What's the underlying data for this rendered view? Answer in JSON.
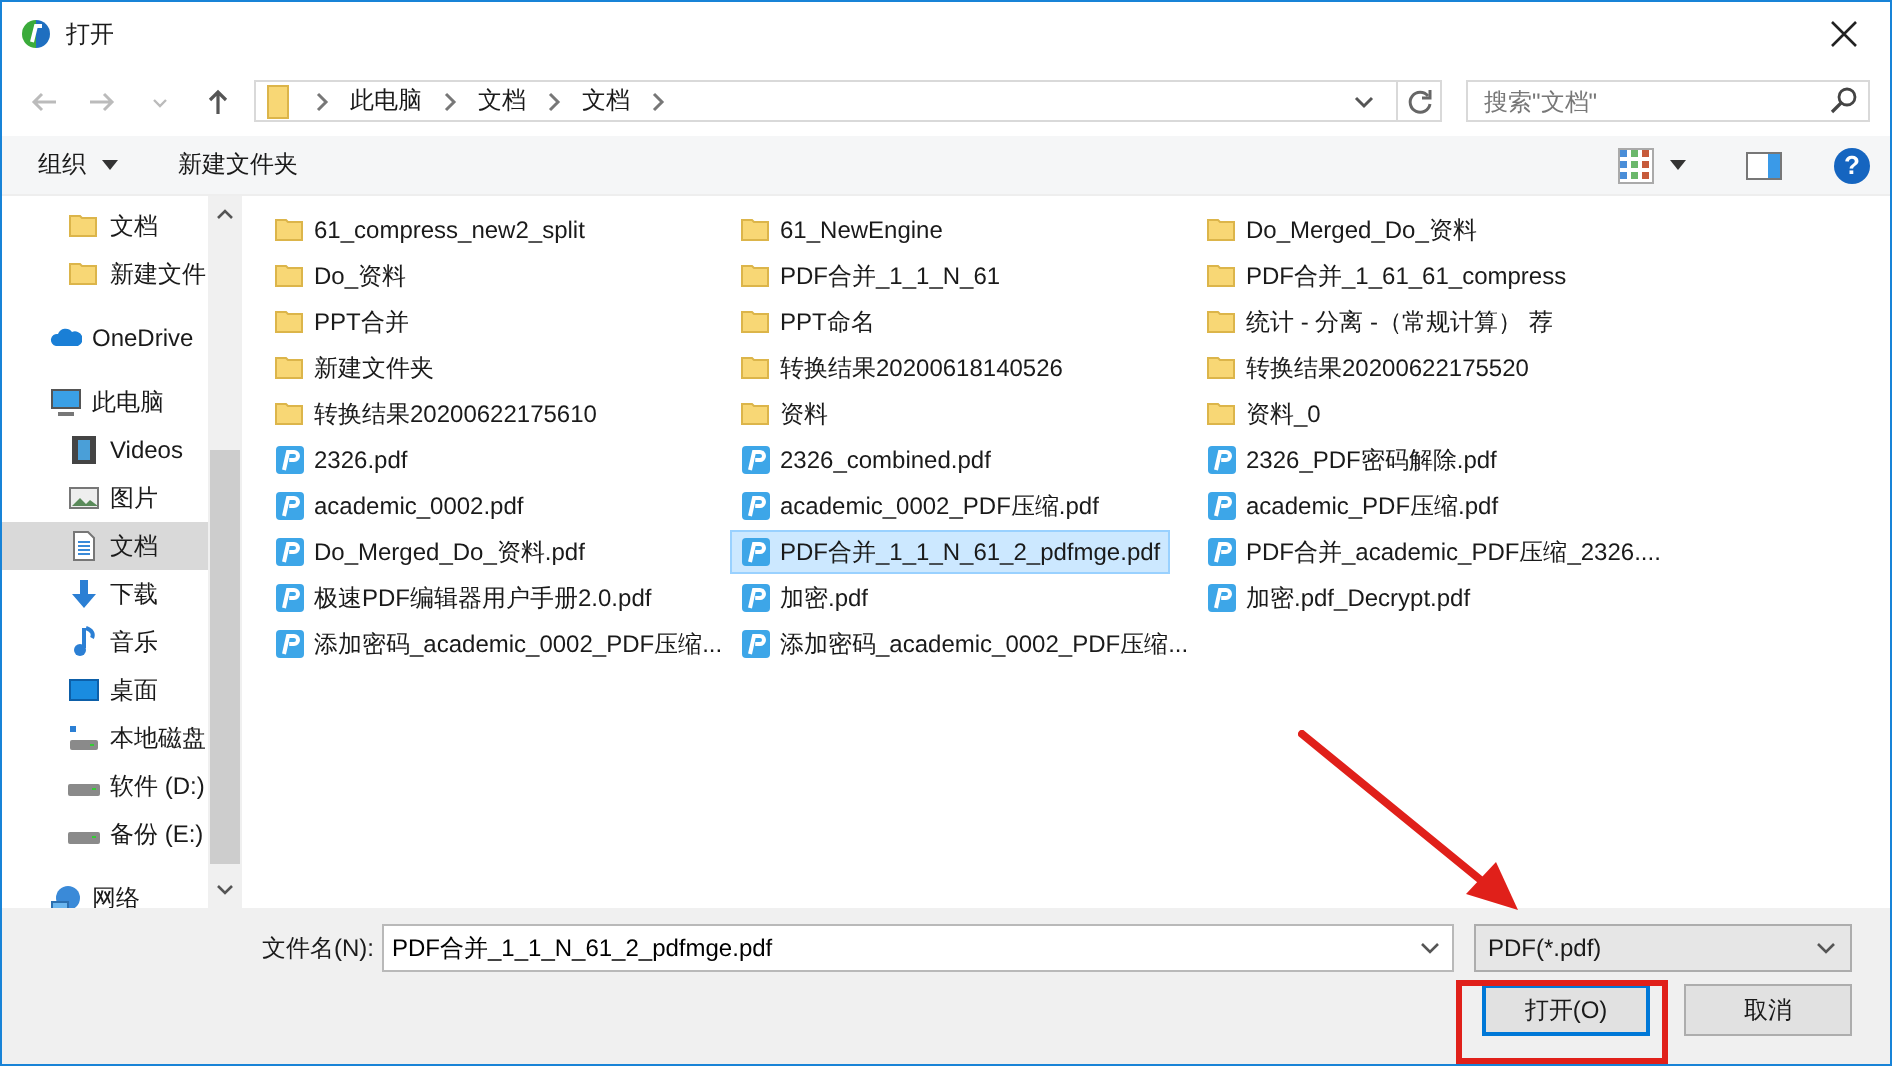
{
  "window": {
    "title": "打开"
  },
  "nav": {
    "breadcrumb": [
      "此电脑",
      "文档",
      "文档"
    ],
    "search": {
      "placeholder": "搜索\"文档\""
    }
  },
  "toolbar": {
    "organize": "组织",
    "new_folder": "新建文件夹",
    "help": "?"
  },
  "sidebar": {
    "items": [
      {
        "children": [
          {
            "label": "文档",
            "kind": "folder",
            "selected": false
          },
          {
            "label": "新建文件",
            "kind": "folder",
            "selected": false
          }
        ]
      },
      {
        "label": "OneDrive",
        "kind": "cloud",
        "selected": false
      },
      {
        "label": "此电脑",
        "kind": "pc",
        "selected": false,
        "children": [
          {
            "label": "Videos",
            "kind": "video",
            "selected": false
          },
          {
            "label": "图片",
            "kind": "picture",
            "selected": false
          },
          {
            "label": "文档",
            "kind": "document",
            "selected": true
          },
          {
            "label": "下载",
            "kind": "download",
            "selected": false
          },
          {
            "label": "音乐",
            "kind": "music",
            "selected": false
          },
          {
            "label": "桌面",
            "kind": "desktop",
            "selected": false
          },
          {
            "label": "本地磁盘",
            "kind": "system-disk",
            "selected": false
          },
          {
            "label": "软件 (D:)",
            "kind": "disk",
            "selected": false
          },
          {
            "label": "备份 (E:)",
            "kind": "disk",
            "selected": false
          }
        ]
      },
      {
        "label": "网络",
        "kind": "network",
        "selected": false
      }
    ]
  },
  "files": [
    {
      "name": "61_compress_new2_split",
      "kind": "folder",
      "selected": false
    },
    {
      "name": "Do_资料",
      "kind": "folder",
      "selected": false
    },
    {
      "name": "PPT合并",
      "kind": "folder",
      "selected": false
    },
    {
      "name": "新建文件夹",
      "kind": "folder",
      "selected": false
    },
    {
      "name": "转换结果20200622175610",
      "kind": "folder",
      "selected": false
    },
    {
      "name": "2326.pdf",
      "kind": "pdf",
      "selected": false
    },
    {
      "name": "academic_0002.pdf",
      "kind": "pdf",
      "selected": false
    },
    {
      "name": "Do_Merged_Do_资料.pdf",
      "kind": "pdf",
      "selected": false
    },
    {
      "name": "极速PDF编辑器用户手册2.0.pdf",
      "kind": "pdf",
      "selected": false
    },
    {
      "name": "添加密码_academic_0002_PDF压缩...",
      "kind": "pdf",
      "selected": false
    },
    {
      "name": "61_NewEngine",
      "kind": "folder",
      "selected": false
    },
    {
      "name": "PDF合并_1_1_N_61",
      "kind": "folder",
      "selected": false
    },
    {
      "name": "PPT命名",
      "kind": "folder",
      "selected": false
    },
    {
      "name": "转换结果20200618140526",
      "kind": "folder",
      "selected": false
    },
    {
      "name": "资料",
      "kind": "folder",
      "selected": false
    },
    {
      "name": "2326_combined.pdf",
      "kind": "pdf",
      "selected": false
    },
    {
      "name": "academic_0002_PDF压缩.pdf",
      "kind": "pdf",
      "selected": false
    },
    {
      "name": "PDF合并_1_1_N_61_2_pdfmge.pdf",
      "kind": "pdf",
      "selected": true
    },
    {
      "name": "加密.pdf",
      "kind": "pdf",
      "selected": false
    },
    {
      "name": "添加密码_academic_0002_PDF压缩...",
      "kind": "pdf",
      "selected": false
    },
    {
      "name": "Do_Merged_Do_资料",
      "kind": "folder",
      "selected": false
    },
    {
      "name": "PDF合并_1_61_61_compress",
      "kind": "folder",
      "selected": false
    },
    {
      "name": "统计 - 分离 -（常规计算） 荐",
      "kind": "folder",
      "selected": false
    },
    {
      "name": "转换结果20200622175520",
      "kind": "folder",
      "selected": false
    },
    {
      "name": "资料_0",
      "kind": "folder",
      "selected": false
    },
    {
      "name": "2326_PDF密码解除.pdf",
      "kind": "pdf",
      "selected": false
    },
    {
      "name": "academic_PDF压缩.pdf",
      "kind": "pdf",
      "selected": false
    },
    {
      "name": "PDF合并_academic_PDF压缩_2326....",
      "kind": "pdf",
      "selected": false
    },
    {
      "name": "加密.pdf_Decrypt.pdf",
      "kind": "pdf",
      "selected": false
    }
  ],
  "bottom": {
    "filename_label": "文件名(N):",
    "filename": "PDF合并_1_1_N_61_2_pdfmge.pdf",
    "filter": "PDF(*.pdf)",
    "open_button": "打开(O)",
    "cancel_button": "取消"
  }
}
